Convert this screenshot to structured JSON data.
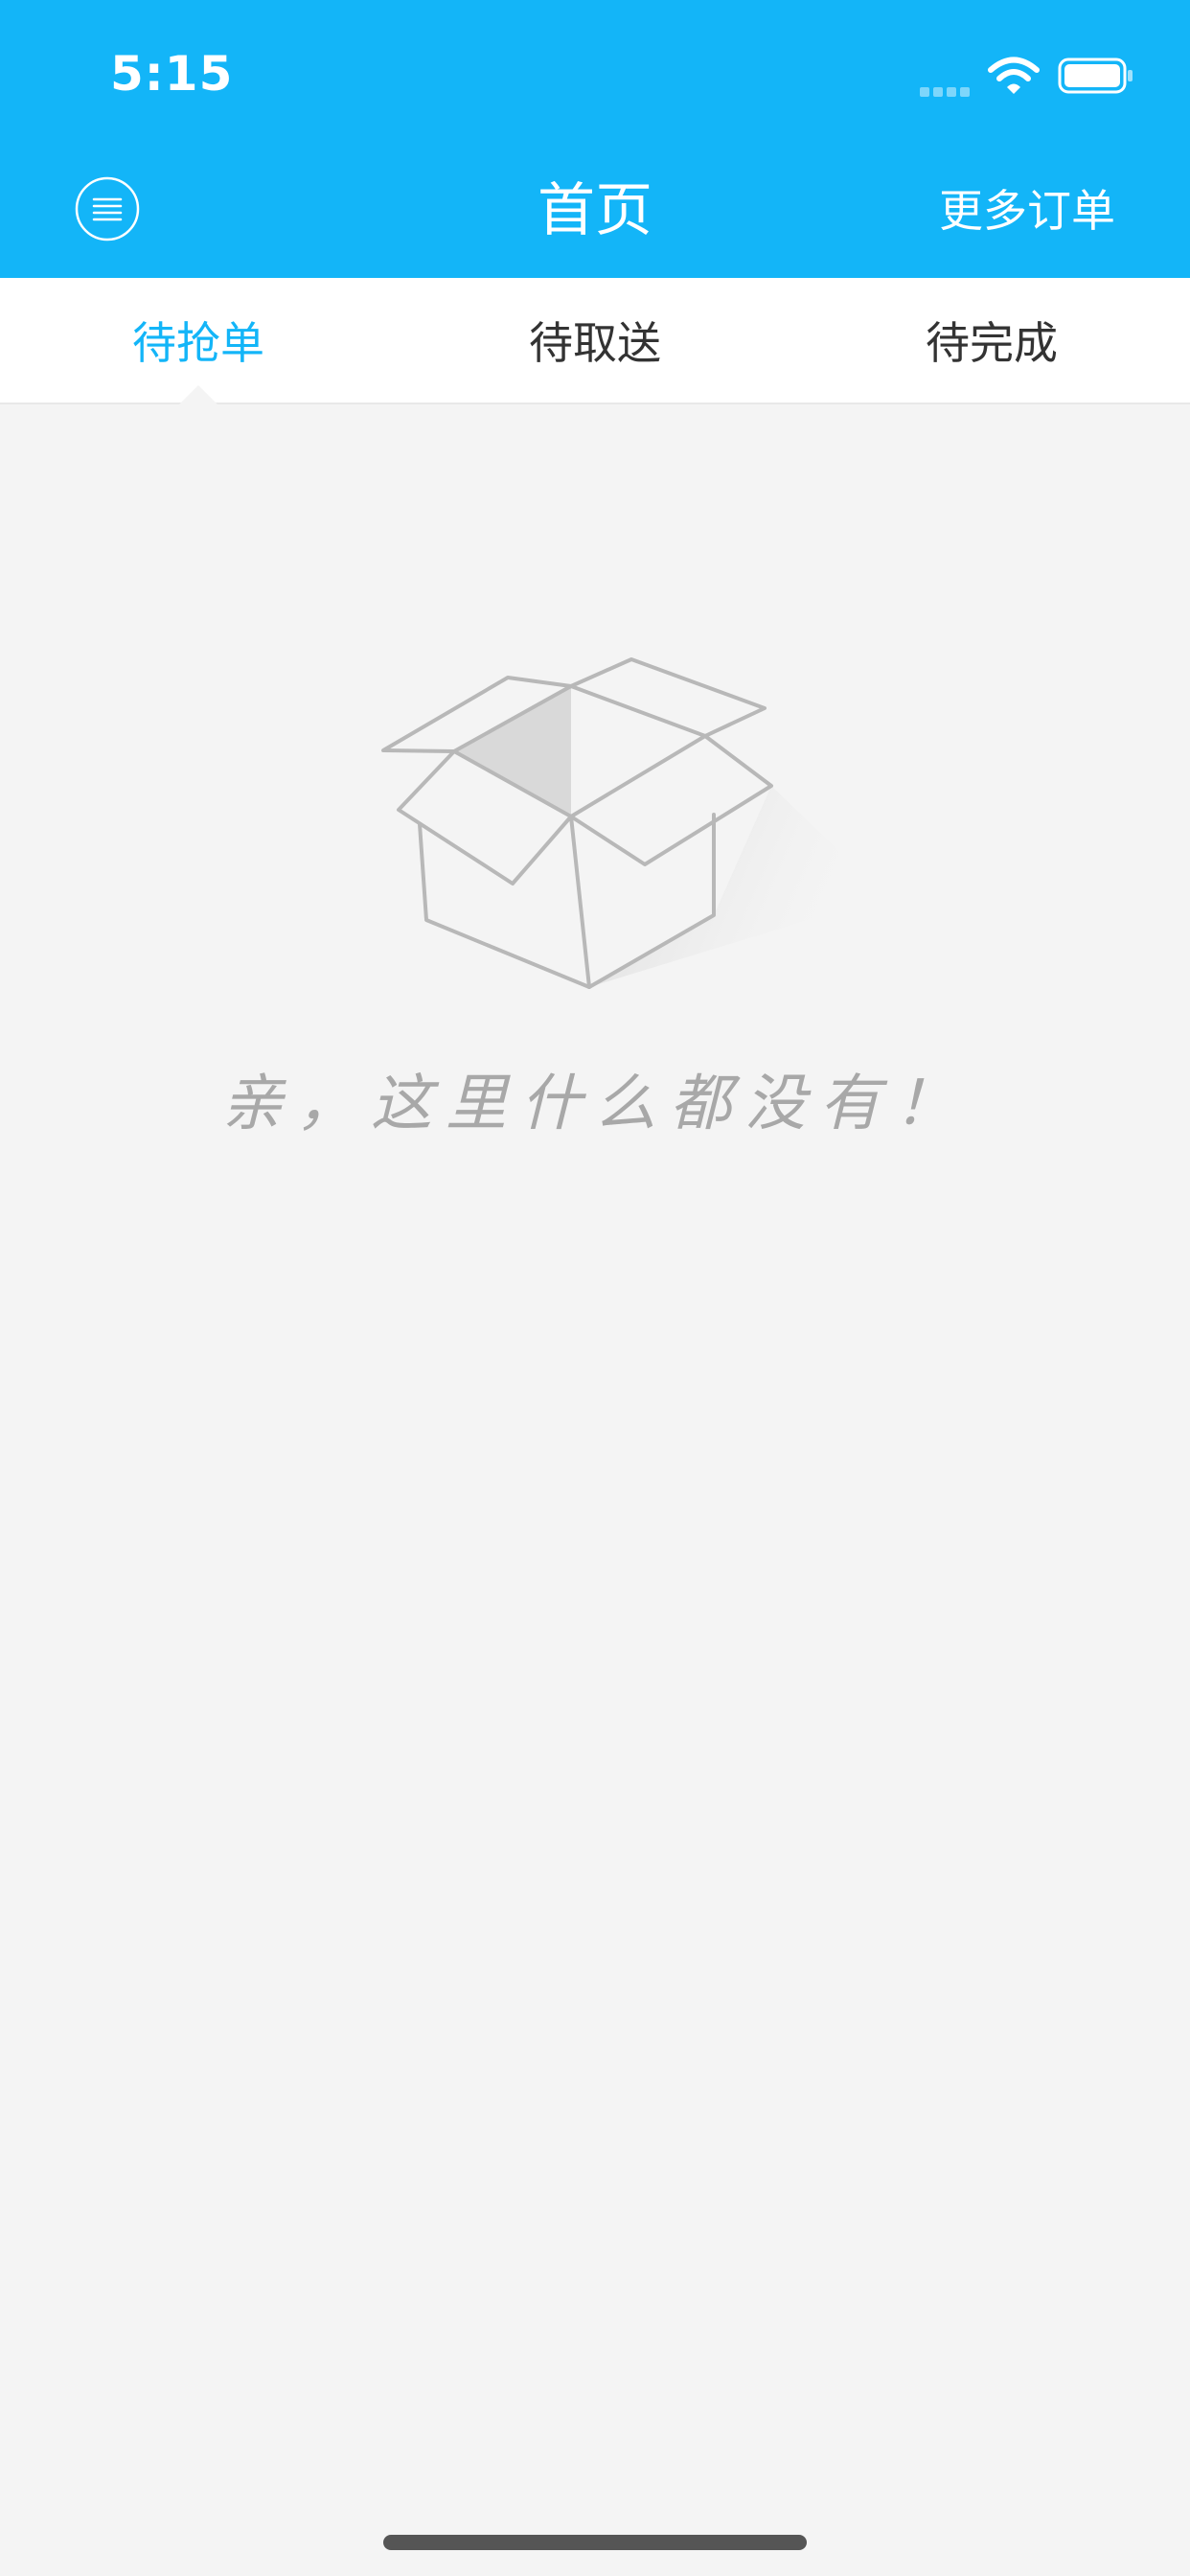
{
  "status_bar": {
    "time": "5:15"
  },
  "nav": {
    "title": "首页",
    "right_label": "更多订单"
  },
  "tabs": [
    {
      "label": "待抢单",
      "active": true
    },
    {
      "label": "待取送",
      "active": false
    },
    {
      "label": "待完成",
      "active": false
    }
  ],
  "empty_state": {
    "message": "亲，这里什么都没有！",
    "icon": "empty-box-icon"
  },
  "colors": {
    "primary": "#13b5f8",
    "background": "#f4f4f4",
    "tab_text": "#333333",
    "empty_text": "#a8a8a8"
  }
}
